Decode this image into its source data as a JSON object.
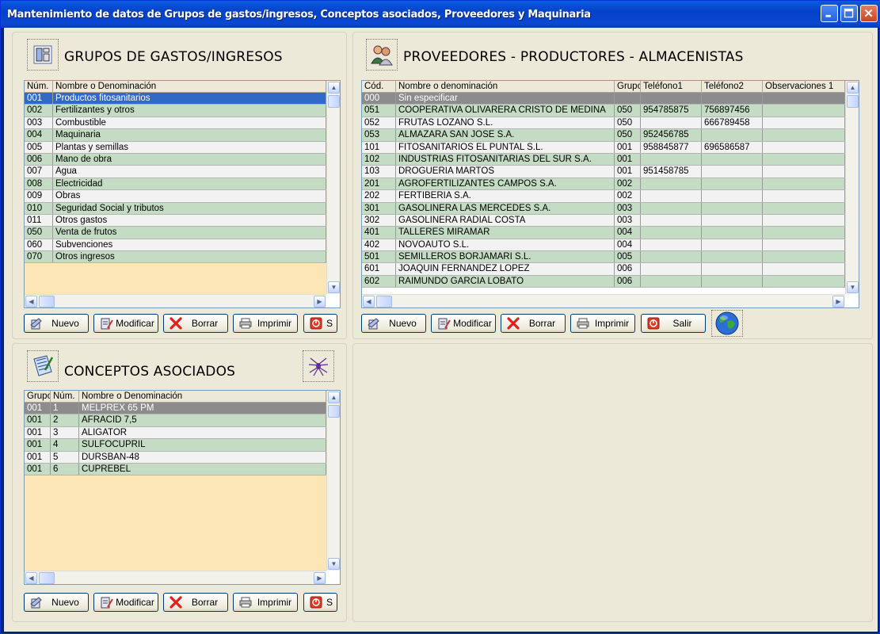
{
  "window": {
    "title": "Mantenimiento de datos de Grupos de gastos/ingresos, Conceptos asociados, Proveedores y Maquinaria"
  },
  "colors": {
    "row_green": "#c4dcc4",
    "row_white": "#f2f2f2",
    "row_selected": "#3169c6",
    "grid_empty": "#fde6b6",
    "titlebar": "#0b47d1"
  },
  "groups": {
    "title": "GRUPOS DE GASTOS/INGRESOS",
    "columns": [
      "Núm.",
      "Nombre o Denominación"
    ],
    "rows": [
      [
        "001",
        "Productos fitosanitarios"
      ],
      [
        "002",
        "Fertilizantes y otros"
      ],
      [
        "003",
        "Combustible"
      ],
      [
        "004",
        "Maquinaria"
      ],
      [
        "005",
        "Plantas y semillas"
      ],
      [
        "006",
        "Mano de obra"
      ],
      [
        "007",
        "Agua"
      ],
      [
        "008",
        "Electricidad"
      ],
      [
        "009",
        "Obras"
      ],
      [
        "010",
        "Seguridad Social y tributos"
      ],
      [
        "011",
        "Otros gastos"
      ],
      [
        "050",
        "Venta de frutos"
      ],
      [
        "060",
        "Subvenciones"
      ],
      [
        "070",
        "Otros ingresos"
      ]
    ],
    "buttons": {
      "new": "Nuevo",
      "edit": "Modificar",
      "delete": "Borrar",
      "print": "Imprimir",
      "exit": "S"
    }
  },
  "suppliers": {
    "title": "PROVEEDORES - PRODUCTORES - ALMACENISTAS",
    "columns": [
      "Cód.",
      "Nombre o denominación",
      "Grupo",
      "Teléfono1",
      "Teléfono2",
      "Observaciones 1"
    ],
    "rows": [
      [
        "000",
        "Sin especificar",
        "",
        "",
        "",
        ""
      ],
      [
        "051",
        "COOPERATIVA OLIVARERA CRISTO DE MEDINA",
        "050",
        "954785875",
        "756897456",
        ""
      ],
      [
        "052",
        "FRUTAS LOZANO S.L.",
        "050",
        "",
        "666789458",
        ""
      ],
      [
        "053",
        "ALMAZARA SAN JOSE S.A.",
        "050",
        "952456785",
        "",
        ""
      ],
      [
        "101",
        "FITOSANITARIOS EL PUNTAL S.L.",
        "001",
        "958845877",
        "696586587",
        ""
      ],
      [
        "102",
        "INDUSTRIAS FITOSANITARIAS DEL SUR S.A.",
        "001",
        "",
        "",
        ""
      ],
      [
        "103",
        "DROGUERIA MARTOS",
        "001",
        "951458785",
        "",
        ""
      ],
      [
        "201",
        "AGROFERTILIZANTES CAMPOS S.A.",
        "002",
        "",
        "",
        ""
      ],
      [
        "202",
        "FERTIBERIA S.A.",
        "002",
        "",
        "",
        ""
      ],
      [
        "301",
        "GASOLINERA LAS MERCEDES S.A.",
        "003",
        "",
        "",
        ""
      ],
      [
        "302",
        "GASOLINERA RADIAL COSTA",
        "003",
        "",
        "",
        ""
      ],
      [
        "401",
        "TALLERES MIRAMAR",
        "004",
        "",
        "",
        ""
      ],
      [
        "402",
        "NOVOAUTO S.L.",
        "004",
        "",
        "",
        ""
      ],
      [
        "501",
        "SEMILLEROS BORJAMARI S.L.",
        "005",
        "",
        "",
        ""
      ],
      [
        "601",
        "JOAQUIN FERNANDEZ LOPEZ",
        "006",
        "",
        "",
        ""
      ],
      [
        "602",
        "RAIMUNDO GARCIA LOBATO",
        "006",
        "",
        "",
        ""
      ]
    ],
    "buttons": {
      "new": "Nuevo",
      "edit": "Modificar",
      "delete": "Borrar",
      "print": "Imprimir",
      "exit": "Salir"
    }
  },
  "concepts": {
    "title": "CONCEPTOS ASOCIADOS",
    "columns": [
      "Grupo",
      "Núm.",
      "Nombre o Denominación"
    ],
    "rows": [
      [
        "001",
        "1",
        "MELPREX 65 PM"
      ],
      [
        "001",
        "2",
        "AFRACID 7,5"
      ],
      [
        "001",
        "3",
        "ALIGATOR"
      ],
      [
        "001",
        "4",
        "SULFOCUPRIL"
      ],
      [
        "001",
        "5",
        "DURSBAN-48"
      ],
      [
        "001",
        "6",
        "CUPREBEL"
      ]
    ],
    "buttons": {
      "new": "Nuevo",
      "edit": "Modificar",
      "delete": "Borrar",
      "print": "Imprimir",
      "exit": "S"
    }
  }
}
